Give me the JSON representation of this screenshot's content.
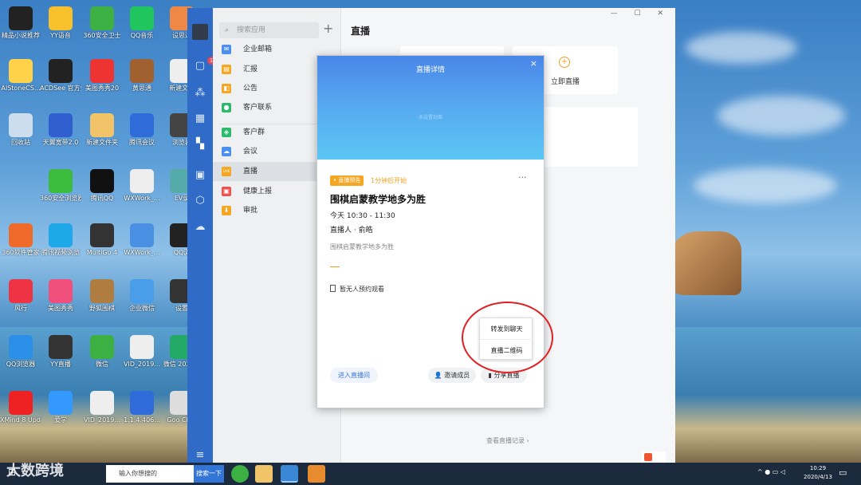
{
  "desktop": {
    "icons": [
      {
        "label": "精品小说推荐",
        "color": "#222"
      },
      {
        "label": "YY语音",
        "color": "#f6c12a"
      },
      {
        "label": "360安全卫士",
        "color": "#3cb043"
      },
      {
        "label": "QQ音乐",
        "color": "#21c55d"
      },
      {
        "label": "设思通",
        "color": "#e84"
      },
      {
        "label": "AIStoneCS...",
        "color": "#ffd24a"
      },
      {
        "label": "ACDSee 官方免费版",
        "color": "#222"
      },
      {
        "label": "美图秀秀20",
        "color": "#e33"
      },
      {
        "label": "黄思通",
        "color": "#a06030"
      },
      {
        "label": "新建文...",
        "color": "#eee"
      },
      {
        "label": "回收站",
        "color": "#cde"
      },
      {
        "label": "天翼宽带2.0",
        "color": "#3060d0"
      },
      {
        "label": "新建文件夹",
        "color": "#f1c46a"
      },
      {
        "label": "腾讯会议",
        "color": "#2f6bd9"
      },
      {
        "label": "浏览器",
        "color": "#444"
      },
      {
        "label": "360安全浏览器",
        "color": "#3dbb3d"
      },
      {
        "label": "腾讯QQ",
        "color": "#111"
      },
      {
        "label": "WXWork_...",
        "color": "#eee"
      },
      {
        "label": "EV录",
        "color": "#5aa"
      },
      {
        "label": "360软件管家",
        "color": "#ef6a2a"
      },
      {
        "label": "腾讯视频浏览",
        "color": "#1fa8e8"
      },
      {
        "label": "MultiGo 4",
        "color": "#333"
      },
      {
        "label": "WXWork_...",
        "color": "#4a90e2"
      },
      {
        "label": "QQ浏",
        "color": "#222"
      },
      {
        "label": "风行",
        "color": "#e34"
      },
      {
        "label": "美图秀秀",
        "color": "#f04f7c"
      },
      {
        "label": "野狐围棋",
        "color": "#b07d40"
      },
      {
        "label": "企业微信",
        "color": "#4a9de8"
      },
      {
        "label": "设置",
        "color": "#333"
      },
      {
        "label": "QQ浏览器",
        "color": "#2b8fe8"
      },
      {
        "label": "YY直播",
        "color": "#333"
      },
      {
        "label": "微信",
        "color": "#3cb043"
      },
      {
        "label": "VID_2019...",
        "color": "#eee"
      },
      {
        "label": "微信 2020...",
        "color": "#2a6"
      },
      {
        "label": "XMind 8 Update 7",
        "color": "#e22"
      },
      {
        "label": "爱学",
        "color": "#39f"
      },
      {
        "label": "VID_2019...",
        "color": "#eee"
      },
      {
        "label": "1.1.4.406...",
        "color": "#2f6bd9"
      },
      {
        "label": "Goo Chro",
        "color": "#ddd"
      }
    ]
  },
  "app": {
    "search_placeholder": "搜索应用",
    "add_icon": "plus-icon",
    "nav": [
      {
        "label": "企业邮箱",
        "color": "#4a8ff0"
      },
      {
        "label": "汇报",
        "color": "#f5a623"
      },
      {
        "label": "公告",
        "color": "#f5a623"
      },
      {
        "label": "客户联系",
        "color": "#2dba6c"
      },
      {
        "label": "客户群",
        "color": "#2dba6c"
      },
      {
        "label": "会议",
        "color": "#4a8ff0"
      },
      {
        "label": "直播",
        "color": "#f5a623"
      },
      {
        "label": "健康上报",
        "color": "#ef5350"
      },
      {
        "label": "审批",
        "color": "#f5a623"
      }
    ],
    "active_nav": "直播",
    "leftbar_badge": "1",
    "page_title": "直播",
    "start_live_label": "立即直播",
    "history_link": "查看直播记录 ›",
    "window_controls": "— ☐ ✕"
  },
  "modal": {
    "title": "直播详情",
    "close": "×",
    "banner_hint": "未设置封面",
    "tag": "• 直播预告",
    "countdown": "1分钟后开始",
    "more": "···",
    "live_title": "围棋启蒙教学地多为胜",
    "time": "今天 10:30 - 11:30",
    "host": "直播人 · 俞皓",
    "description": "围棋启蒙教学地多为胜",
    "no_reservation": "暂无人预约观看",
    "enter_room": "进入直播间",
    "invite": "邀请成员",
    "share": "分享直播"
  },
  "popup_menu": {
    "items": [
      "转发到聊天",
      "直播二维码"
    ]
  },
  "taskbar": {
    "search_placeholder": "输入你想搜的",
    "search_button": "搜索一下",
    "time": "10:29",
    "date": "2020/4/13"
  },
  "watermark": "大数跨境"
}
